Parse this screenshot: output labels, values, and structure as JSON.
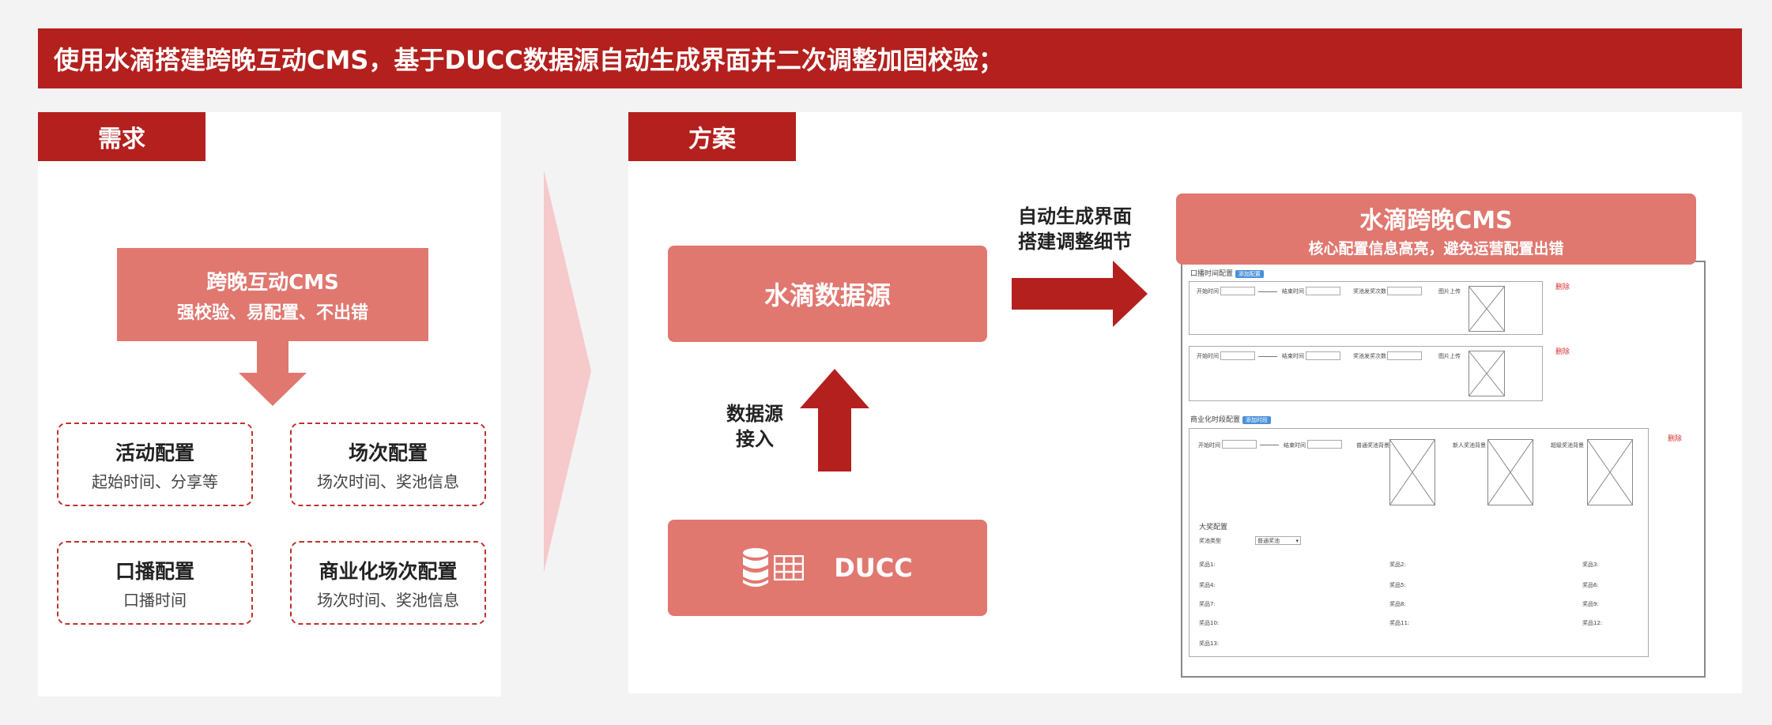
{
  "header": {
    "title": "使用水滴搭建跨晚互动CMS，基于DUCC数据源自动生成界面并二次调整加固校验；"
  },
  "left": {
    "tab": "需求",
    "main_box": {
      "title": "跨晚互动CMS",
      "subtitle": "强校验、易配置、不出错"
    },
    "cards": [
      {
        "title": "活动配置",
        "subtitle": "起始时间、分享等"
      },
      {
        "title": "场次配置",
        "subtitle": "场次时间、奖池信息"
      },
      {
        "title": "口播配置",
        "subtitle": "口播时间"
      },
      {
        "title": "商业化场次配置",
        "subtitle": "场次时间、奖池信息"
      }
    ]
  },
  "right": {
    "tab": "方案",
    "datasource_box": "水滴数据源",
    "ducc_box": "DUCC",
    "access_label": [
      "数据源",
      "接入"
    ],
    "auto_label": [
      "自动生成界面",
      "搭建调整细节"
    ],
    "cms_box": {
      "title": "水滴跨晚CMS",
      "subtitle": "核心配置信息高亮，避免运营配置出错"
    },
    "mock": {
      "sec1": {
        "title": "口播时间配置",
        "badge": "添加配置"
      },
      "row_fields": [
        "开始时间",
        "结束时间",
        "奖池发奖次数",
        "图片上传"
      ],
      "row2_fields": [
        "开始时间",
        "结束时间",
        "奖池发奖次数",
        "图片上传"
      ],
      "delete": "删除",
      "sec2": {
        "title": "商业化时段配置",
        "badge": "添加时段"
      },
      "sec2_fields": [
        "开始时间",
        "结束时间",
        "普通奖池背景",
        "新人奖池背景",
        "超级奖池背景"
      ],
      "grand": {
        "title": "大奖配置",
        "type_label": "奖池类型",
        "type_value": "普通奖池"
      },
      "prizes": [
        "奖品1:",
        "奖品2:",
        "奖品3:",
        "奖品4:",
        "奖品5:",
        "奖品6:",
        "奖品7:",
        "奖品8:",
        "奖品9:",
        "奖品10:",
        "奖品11:",
        "奖品12:",
        "奖品13:"
      ]
    }
  },
  "colors": {
    "brand_red": "#b3201d",
    "pink": "#e07870",
    "pale_arrow": "#f6c9cb"
  }
}
